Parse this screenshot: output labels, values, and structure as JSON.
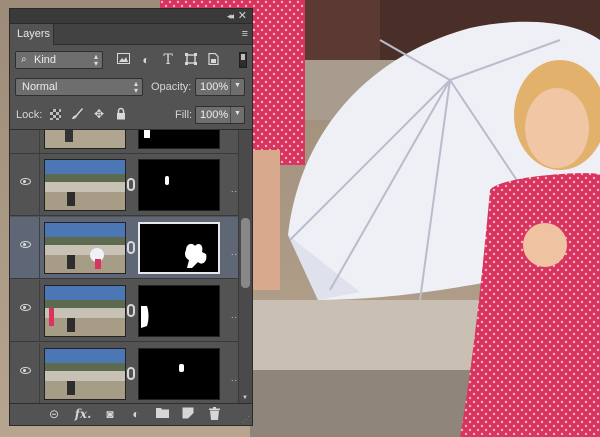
{
  "panel": {
    "collapse_glyph": "◂◂",
    "close_glyph": "✕",
    "tab_label": "Layers",
    "menu_glyph": "≡",
    "filter": {
      "kind_label": "Kind",
      "icons": [
        "image-filter-icon",
        "adjustment-filter-icon",
        "type-filter-icon",
        "shape-filter-icon",
        "smart-object-filter-icon"
      ]
    },
    "blend_mode": "Normal",
    "opacity_label": "Opacity:",
    "opacity_value": "100%",
    "lock_label": "Lock:",
    "fill_label": "Fill:",
    "fill_value": "100%",
    "layers": [
      {
        "visible": false,
        "selected": false,
        "mask": "partial-top"
      },
      {
        "visible": true,
        "selected": false,
        "mask": "small-spot"
      },
      {
        "visible": true,
        "selected": true,
        "mask": "umbrella-blob"
      },
      {
        "visible": true,
        "selected": false,
        "mask": "left-blob"
      },
      {
        "visible": true,
        "selected": false,
        "mask": "tiny-spot"
      }
    ],
    "row_menu_glyph": "..",
    "bottom_toolbar": {
      "link_glyph": "⊝",
      "fx_label": "fx.",
      "mask_glyph": "◙",
      "adjust_glyph": "◐",
      "folder_glyph": "▬",
      "new_layer_glyph": "◲",
      "trash_glyph": "🗑"
    }
  }
}
